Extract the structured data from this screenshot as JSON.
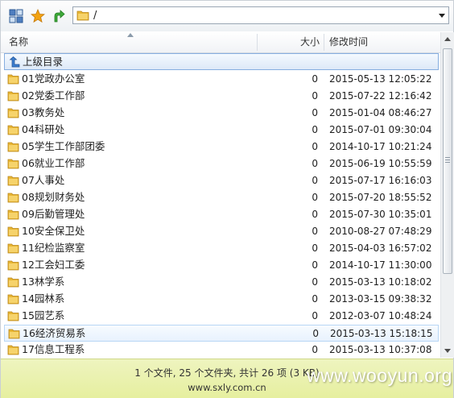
{
  "path": {
    "value": "/"
  },
  "columns": {
    "name": "名称",
    "size": "大小",
    "modified": "修改时间"
  },
  "parent": {
    "label": "上级目录"
  },
  "rows": [
    {
      "name": "01党政办公室",
      "size": "0",
      "date": "2015-05-13 12:05:22"
    },
    {
      "name": "02党委工作部",
      "size": "0",
      "date": "2015-07-22 12:16:42"
    },
    {
      "name": "03教务处",
      "size": "0",
      "date": "2015-01-04 08:46:27"
    },
    {
      "name": "04科研处",
      "size": "0",
      "date": "2015-07-01 09:30:04"
    },
    {
      "name": "05学生工作部团委",
      "size": "0",
      "date": "2014-10-17 10:21:24"
    },
    {
      "name": "06就业工作部",
      "size": "0",
      "date": "2015-06-19 10:55:59"
    },
    {
      "name": "07人事处",
      "size": "0",
      "date": "2015-07-17 16:16:03"
    },
    {
      "name": "08规划财务处",
      "size": "0",
      "date": "2015-07-20 18:55:52"
    },
    {
      "name": "09后勤管理处",
      "size": "0",
      "date": "2015-07-30 10:35:01"
    },
    {
      "name": "10安全保卫处",
      "size": "0",
      "date": "2010-08-27 07:48:29"
    },
    {
      "name": "11纪检监察室",
      "size": "0",
      "date": "2015-04-03 16:57:02"
    },
    {
      "name": "12工会妇工委",
      "size": "0",
      "date": "2014-10-17 11:30:00"
    },
    {
      "name": "13林学系",
      "size": "0",
      "date": "2015-03-13 10:18:02"
    },
    {
      "name": "14园林系",
      "size": "0",
      "date": "2013-03-15 09:38:32"
    },
    {
      "name": "15园艺系",
      "size": "0",
      "date": "2012-03-07 10:48:24"
    },
    {
      "name": "16经济贸易系",
      "size": "0",
      "date": "2015-03-13 15:18:15"
    },
    {
      "name": "17信息工程系",
      "size": "0",
      "date": "2015-03-13 10:37:08"
    }
  ],
  "status": {
    "summary": "1 个文件, 25 个文件夹, 共计 26 项 (3 KB)",
    "site": "www.sxly.com.cn"
  },
  "watermark": "www.wooyun.org",
  "colors": {
    "folder": "#e8b634",
    "status_bg": "#e9f1ae",
    "selection_border": "#86aee0"
  },
  "icons": {
    "view": "view-mode-icon",
    "favorite": "star-icon",
    "up": "up-arrow-icon",
    "parent": "parent-directory-icon",
    "folder": "folder-icon"
  }
}
